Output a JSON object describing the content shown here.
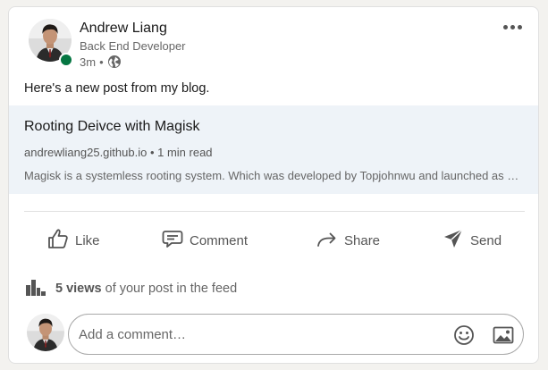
{
  "post": {
    "author_name": "Andrew Liang",
    "author_headline": "Back End Developer",
    "time_ago": "3m",
    "separator": "•",
    "text": "Here's a new post from my blog."
  },
  "link_preview": {
    "title": "Rooting Deivce with Magisk",
    "domain": "andrewliang25.github.io",
    "read_time": "• 1 min read",
    "description": "Magisk is a systemless rooting system. Which was developed by Topjohnwu and launched as an alternative to SuperSU"
  },
  "actions": [
    {
      "label": "Like",
      "icon": "thumbs-up-icon"
    },
    {
      "label": "Comment",
      "icon": "comment-icon"
    },
    {
      "label": "Share",
      "icon": "share-arrow-icon"
    },
    {
      "label": "Send",
      "icon": "send-icon"
    }
  ],
  "views": {
    "count_label": "5 views",
    "suffix": "of your post in the feed"
  },
  "comment": {
    "placeholder": "Add a comment…"
  },
  "colors": {
    "presence": "#057642",
    "preview_bg": "#eef3f8",
    "muted_text": "#666666"
  }
}
